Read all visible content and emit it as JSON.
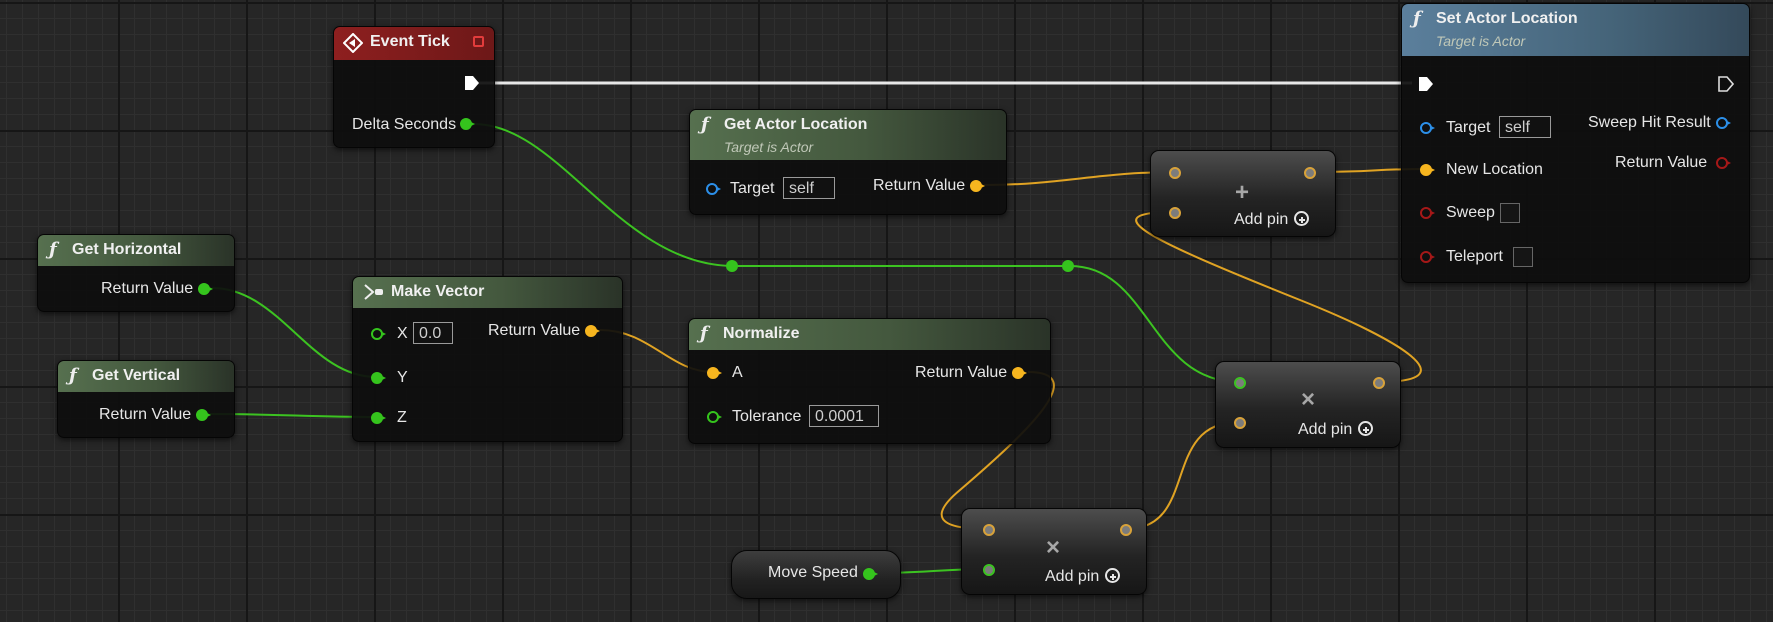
{
  "colors": {
    "float_pin": "#35c41d",
    "vector_pin": "#f6b51f",
    "object_pin": "#2c8fe8",
    "bool_pin": "#a51818",
    "exec_wire": "#e8e8e8"
  },
  "nodes": {
    "event_tick": {
      "title": "Event Tick",
      "icon": "event-diamond-icon",
      "delta_label": "Delta Seconds"
    },
    "get_actor_location": {
      "title": "Get Actor Location",
      "subtitle": "Target is Actor",
      "target_label": "Target",
      "target_value": "self",
      "return_label": "Return Value"
    },
    "set_actor_location": {
      "title": "Set Actor Location",
      "subtitle": "Target is Actor",
      "target_label": "Target",
      "target_value": "self",
      "new_location_label": "New Location",
      "sweep_label": "Sweep",
      "teleport_label": "Teleport",
      "sweep_hit_label": "Sweep Hit Result",
      "return_label": "Return Value"
    },
    "get_horizontal": {
      "title": "Get Horizontal",
      "return_label": "Return Value"
    },
    "get_vertical": {
      "title": "Get Vertical",
      "return_label": "Return Value"
    },
    "make_vector": {
      "title": "Make Vector",
      "x_label": "X",
      "x_value": "0.0",
      "y_label": "Y",
      "z_label": "Z",
      "return_label": "Return Value"
    },
    "normalize": {
      "title": "Normalize",
      "a_label": "A",
      "tolerance_label": "Tolerance",
      "tolerance_value": "0.0001",
      "return_label": "Return Value"
    },
    "add_vector": {
      "op": "+",
      "add_pin_label": "Add pin"
    },
    "multiply_right": {
      "op": "×",
      "add_pin_label": "Add pin"
    },
    "multiply_bottom": {
      "op": "×",
      "add_pin_label": "Add pin"
    },
    "move_speed": {
      "label": "Move Speed"
    }
  }
}
